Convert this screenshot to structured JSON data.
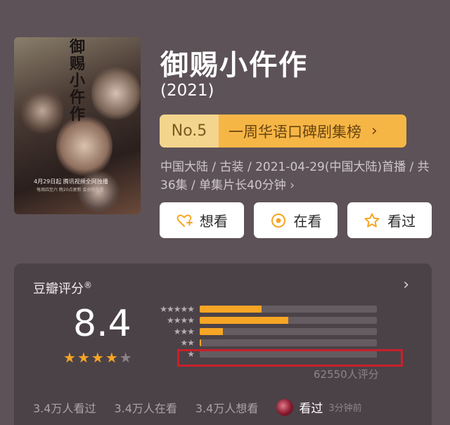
{
  "poster": {
    "title": "御赐小仵作",
    "date_text": "4月29日起 腾讯视频全网独播",
    "sub_text": "每周四至六 晚20点更新 会员抢先看"
  },
  "show": {
    "title": "御赐小仵作",
    "year": "(2021)",
    "meta": "中国大陆 / 古装 / 2021-04-29(中国大陆)首播 / 共36集 / 单集片长40分钟",
    "meta_chevron": "›"
  },
  "rank": {
    "number": "No.5",
    "list": "一周华语口碑剧集榜",
    "chevron": "›"
  },
  "actions": [
    {
      "label": "想看",
      "icon": "heart-plus-icon"
    },
    {
      "label": "在看",
      "icon": "target-circle-icon"
    },
    {
      "label": "看过",
      "icon": "star-outline-icon"
    }
  ],
  "rating": {
    "heading": "豆瓣评分",
    "reg": "®",
    "chevron": "›",
    "score": "8.4",
    "stars_filled": 4,
    "stars_total": 5,
    "distribution": [
      {
        "stars": "★★★★★",
        "fraction": 0.35
      },
      {
        "stars": "★★★★",
        "fraction": 0.5
      },
      {
        "stars": "★★★",
        "fraction": 0.13
      },
      {
        "stars": "★★",
        "fraction": 0.008
      },
      {
        "stars": "★",
        "fraction": 0.0
      }
    ],
    "votes": "62550人评分"
  },
  "footer": {
    "seen": "3.4万人看过",
    "watching": "3.4万人在看",
    "want": "3.4万人想看",
    "friend_action": "看过",
    "time_ago": "3分钟前"
  },
  "colors": {
    "background": "#5d5257",
    "accent": "#f6a524",
    "rank_left": "#f4d58e",
    "rank_right": "#f6b646",
    "highlight_box": "#c8202a"
  }
}
